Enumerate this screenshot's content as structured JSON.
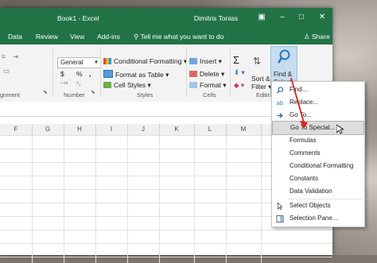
{
  "window": {
    "title": "Book1 - Excel",
    "user": "Dimitris Tonias"
  },
  "tabs": [
    "Data",
    "Review",
    "View",
    "Add-ins"
  ],
  "tell_me": "Tell me what you want to do",
  "share": "Share",
  "ribbon": {
    "alignment_label": "gnment",
    "number_format": "General",
    "number_label": "Number",
    "currency_symbol": "$",
    "percent_symbol": "%",
    "comma_symbol": ",",
    "conditional_formatting": "Conditional Formatting",
    "format_as_table": "Format as Table",
    "cell_styles": "Cell Styles",
    "styles_label": "Styles",
    "insert": "Insert",
    "delete": "Delete",
    "format": "Format",
    "cells_label": "Cells",
    "sort_filter": [
      "Sort &",
      "Filter"
    ],
    "find_select": [
      "Find &",
      "Select"
    ],
    "editing_label": "Editing",
    "sum_symbol": "Σ"
  },
  "columns": [
    "F",
    "G",
    "H",
    "I",
    "J",
    "K",
    "L",
    "M"
  ],
  "menu": {
    "items": [
      {
        "label": "Find...",
        "icon": "magnifier-icon"
      },
      {
        "label": "Replace...",
        "icon": "replace-icon"
      },
      {
        "label": "Go To...",
        "icon": "arrow-right-icon"
      },
      {
        "label": "Go To Special...",
        "icon": ""
      },
      {
        "label": "Formulas",
        "icon": ""
      },
      {
        "label": "Comments",
        "icon": ""
      },
      {
        "label": "Conditional Formatting",
        "icon": ""
      },
      {
        "label": "Constants",
        "icon": ""
      },
      {
        "label": "Data Validation",
        "icon": ""
      },
      {
        "label": "Select Objects",
        "icon": "pointer-icon"
      },
      {
        "label": "Selection Pane...",
        "icon": "selection-pane-icon"
      }
    ],
    "highlighted": "Go To Special..."
  },
  "colors": {
    "excel_green": "#217346",
    "highlight": "#dcdcdc",
    "find_button": "#c6ddef"
  }
}
